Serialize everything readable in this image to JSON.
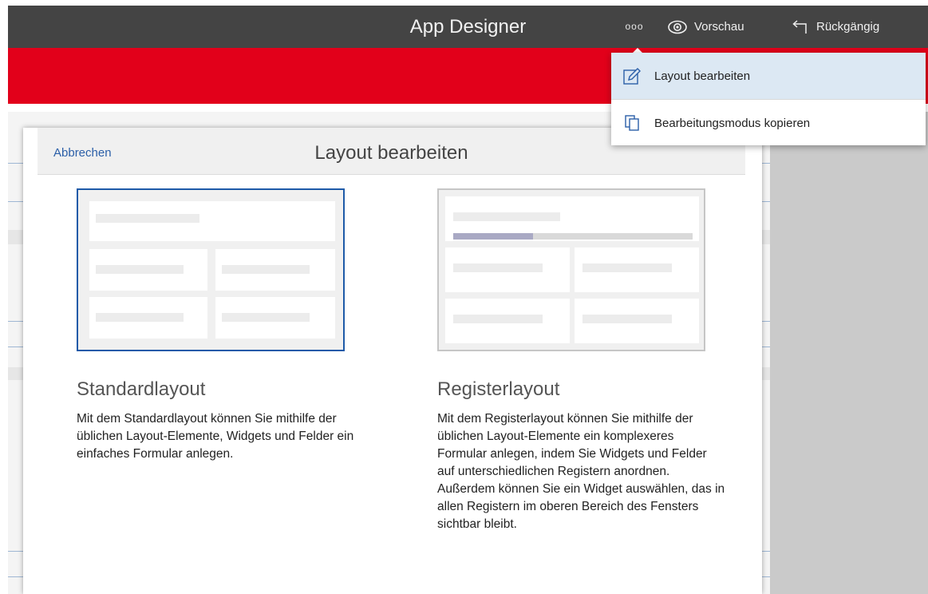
{
  "header": {
    "app_title": "App Designer",
    "more_label": "ooo",
    "preview_label": "Vorschau",
    "undo_label": "Rückgängig"
  },
  "menu": {
    "items": [
      {
        "label": "Layout bearbeiten",
        "icon": "edit-layout-icon"
      },
      {
        "label": "Bearbeitungsmodus kopieren",
        "icon": "copy-icon"
      }
    ]
  },
  "dialog": {
    "cancel_label": "Abbrechen",
    "title": "Layout bearbeiten",
    "options": [
      {
        "title": "Standardlayout",
        "description": "Mit dem Standardlayout können Sie mithilfe der üblichen Layout-Elemente, Widgets und Felder ein einfaches Formular anlegen.",
        "selected": true
      },
      {
        "title": "Registerlayout",
        "description": "Mit dem Registerlayout können Sie mithilfe der üblichen Layout-Elemente ein komplexeres Formular anlegen, indem Sie Widgets und Felder auf unterschiedlichen Registern anordnen. Außerdem können Sie ein Widget auswählen, das in allen Registern im oberen Bereich des Fensters sichtbar bleibt.",
        "selected": false
      }
    ]
  },
  "colors": {
    "topbar": "#444444",
    "brand_red": "#e2001a",
    "link_blue": "#2b5fa8",
    "selection_blue": "#1e5aa8",
    "menu_highlight": "#dce8f3"
  }
}
